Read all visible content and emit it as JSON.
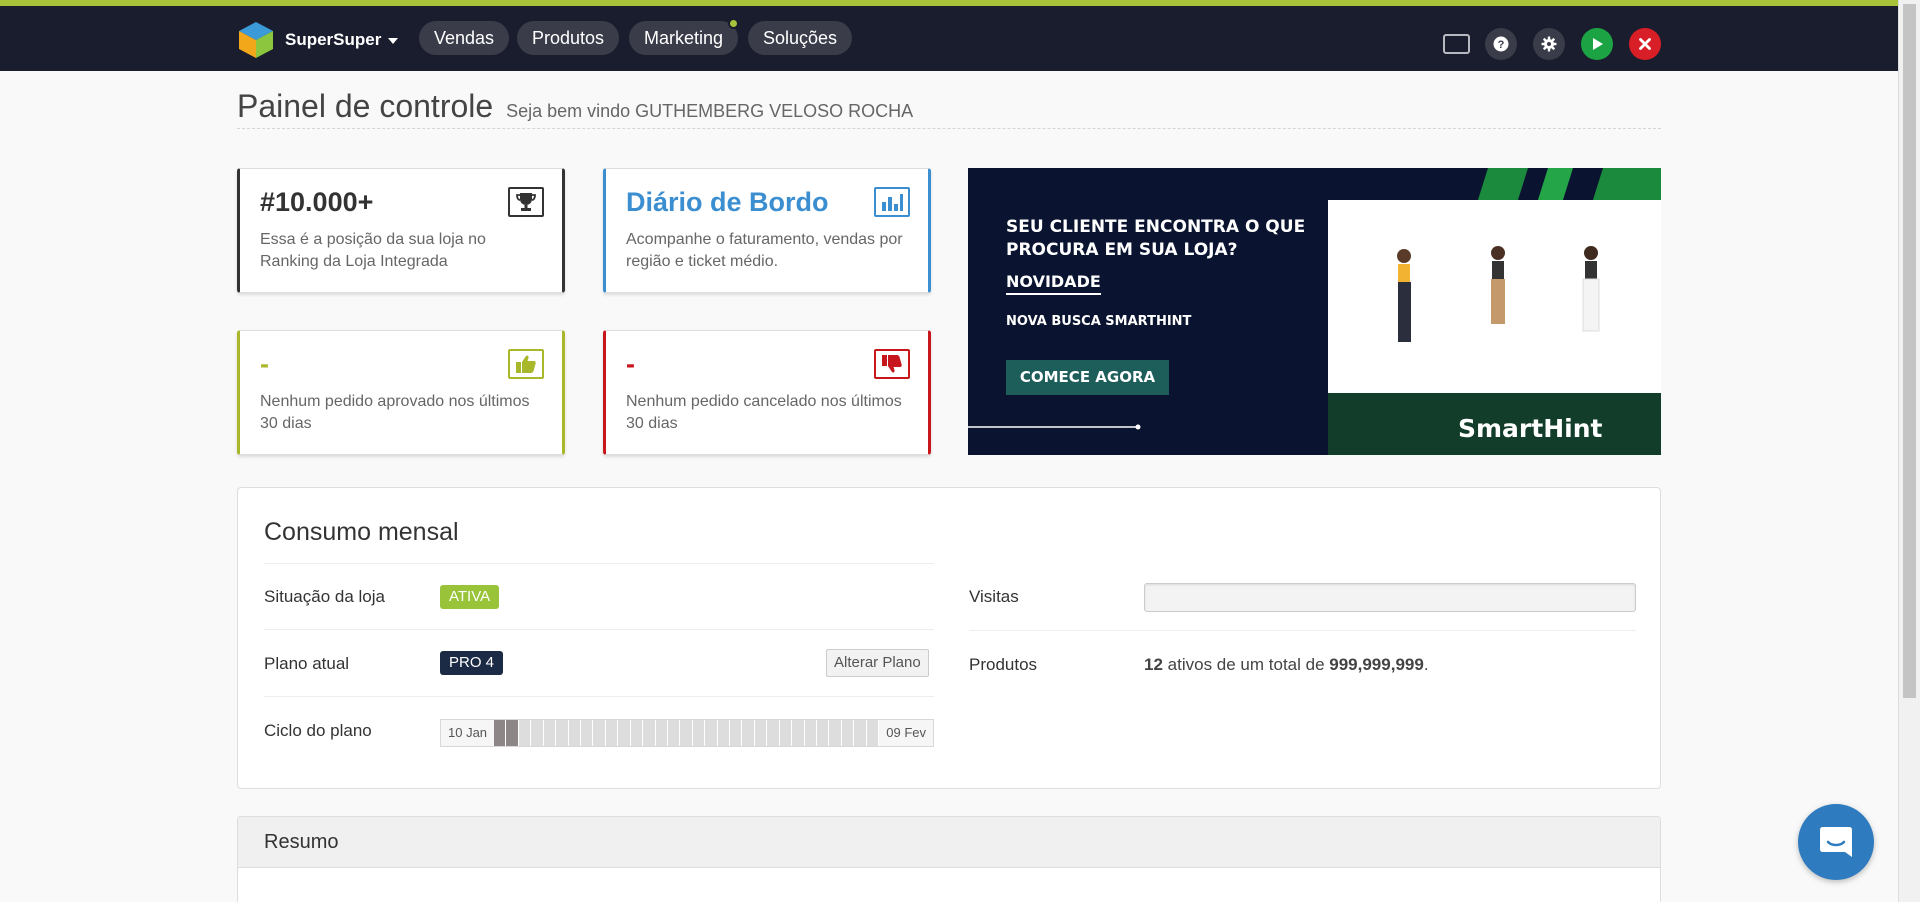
{
  "header": {
    "brand": "SuperSuper",
    "nav": [
      "Vendas",
      "Produtos",
      "Marketing",
      "Soluções"
    ],
    "colors": {
      "bar": "#1a1d2e",
      "accent": "#a8c23a",
      "play": "#1ca344",
      "close": "#d81e26"
    },
    "icons": [
      "screen-icon",
      "help-icon",
      "gear-icon",
      "play-icon",
      "close-icon"
    ]
  },
  "title": {
    "main": "Painel de controle",
    "sub": "Seja bem vindo GUTHEMBERG VELOSO ROCHA"
  },
  "cards": {
    "ranking": {
      "title": "#10.000+",
      "text": "Essa é a posição da sua loja no Ranking da Loja Integrada",
      "icon": "trophy-icon"
    },
    "diario": {
      "title": "Diário de Bordo",
      "text": "Acompanhe o faturamento, vendas por região e ticket médio.",
      "icon": "bar-chart-icon"
    },
    "aprovados": {
      "title": "-",
      "text": "Nenhum pedido aprovado nos últimos 30 dias",
      "icon": "thumbs-up-icon"
    },
    "cancelados": {
      "title": "-",
      "text": "Nenhum pedido cancelado nos últimos 30 dias",
      "icon": "thumbs-down-icon"
    }
  },
  "banner": {
    "headline1": "SEU CLIENTE ENCONTRA O QUE",
    "headline2": "PROCURA EM SUA LOJA?",
    "tag": "NOVIDADE",
    "subline": "NOVA BUSCA SMARTHINT",
    "cta": "COMECE AGORA",
    "brand": "SmartHint"
  },
  "consumo": {
    "title": "Consumo mensal",
    "situacao_label": "Situação da loja",
    "situacao_value": "ATIVA",
    "plano_label": "Plano atual",
    "plano_value": "PRO 4",
    "alterar": "Alterar Plano",
    "ciclo_label": "Ciclo do plano",
    "ciclo_start": "10 Jan",
    "ciclo_end": "09 Fev",
    "ciclo_total_days": 31,
    "ciclo_elapsed_days": 2,
    "visitas_label": "Visitas",
    "produtos_label": "Produtos",
    "produtos_ativos": "12",
    "produtos_mid": "ativos de um total de",
    "produtos_total": "999,999,999",
    "produtos_end": "."
  },
  "resumo": {
    "title": "Resumo"
  }
}
